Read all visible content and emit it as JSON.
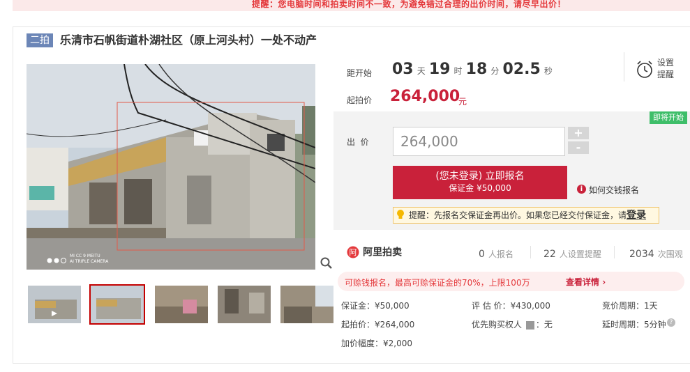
{
  "warning": "提醒：您电脑时间和拍卖时间不一致，为避免错过合理的出价时间，请尽早出价！",
  "title": {
    "round": "二拍",
    "text": "乐清市石帆街道朴湖社区（原上河头村）一处不动产"
  },
  "photo": {
    "watermark_line1": "MI CC 9 MEITU",
    "watermark_line2": "AI TRIPLE CAMERA"
  },
  "countdown": {
    "label": "距开始",
    "days": "03",
    "days_unit": "天",
    "hours": "19",
    "hours_unit": "时",
    "minutes": "18",
    "minutes_unit": "分",
    "seconds": "02.5",
    "seconds_unit": "秒"
  },
  "remind": {
    "label_line1": "设置",
    "label_line2": "提醒"
  },
  "start_price": {
    "label": "起拍价",
    "value": "264,000",
    "unit": "元"
  },
  "status_badge": "即将开始",
  "bid": {
    "label": "出  价",
    "value": "264,000",
    "plus": "+",
    "minus": "-"
  },
  "signup": {
    "line1": "(您未登录) 立即报名",
    "line2": "保证金 ¥50,000"
  },
  "howto": {
    "icon": "i",
    "label": "如何交钱报名"
  },
  "tip": {
    "text": "提醒：先报名交保证金再出价。如果您已经交付保证金，请",
    "login": "登录"
  },
  "brand": "阿里拍卖",
  "stats": [
    {
      "num": "0",
      "label": "人报名"
    },
    {
      "num": "22",
      "label": "人设置提醒"
    },
    {
      "num": "2034",
      "label": "次围观"
    }
  ],
  "promo": {
    "text": "可赊钱报名，最高可赊保证金的70%，上限100万",
    "link": "查看详情"
  },
  "info": {
    "deposit": "保证金：¥50,000",
    "appraisal": "评 估 价：¥430,000",
    "cycle": "竞价周期：1天",
    "start": "起拍价：¥264,000",
    "priority_label": "优先购买权人",
    "priority_value": "：无",
    "delay": "延时周期：5分钟",
    "increment": "加价幅度：¥2,000"
  },
  "colors": {
    "accent": "#c9213a",
    "badge_blue": "#6c86b7",
    "green": "#3ebe69"
  }
}
